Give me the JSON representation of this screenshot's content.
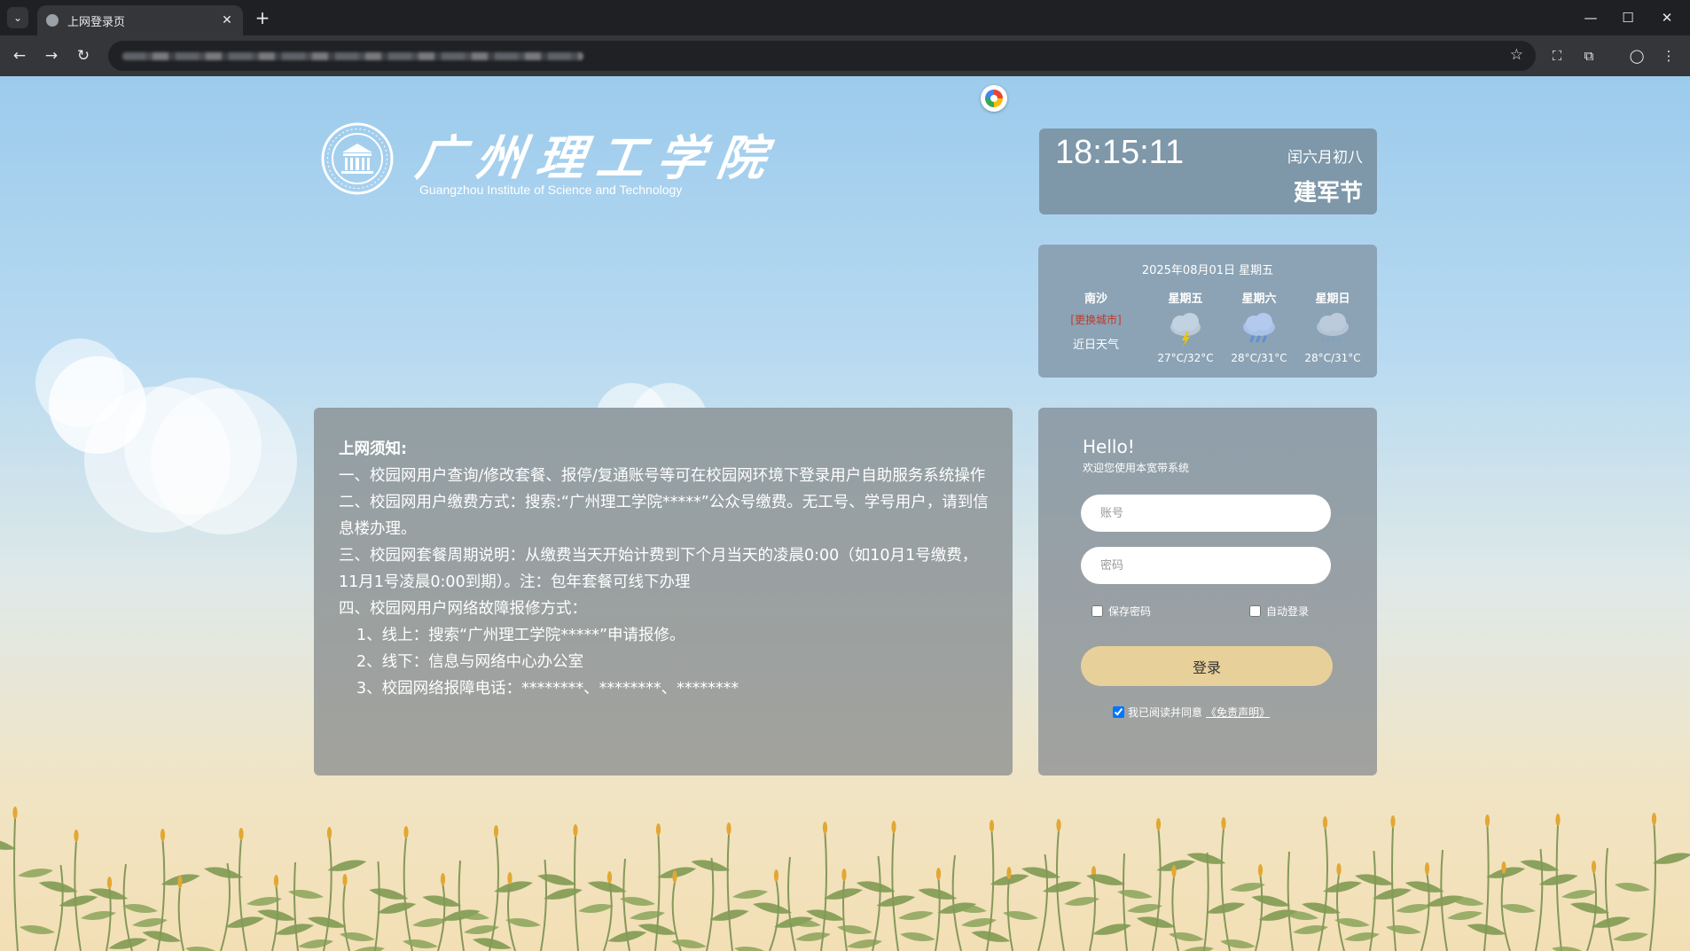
{
  "browser": {
    "tab_title": "上网登录页",
    "tab_close": "✕",
    "new_tab": "+",
    "tab_list": "⌄",
    "window": {
      "minimize": "—",
      "maximize": "☐",
      "close": "✕"
    },
    "nav": {
      "back": "←",
      "forward": "→",
      "reload": "↻"
    },
    "bookmark": "☆",
    "toolbar_icons": {
      "screenshot": "⛶",
      "extensions": "⧉",
      "profile": "◯",
      "menu": "⋮"
    }
  },
  "header": {
    "school_name_cn": "广州理工学院",
    "school_name_en": "Guangzhou Institute of Science and Technology"
  },
  "clock": {
    "time": "18:15:11",
    "lunar_date": "闰六月初八",
    "festival": "建军节"
  },
  "weather": {
    "date": "2025年08月01日 星期五",
    "city": "南沙",
    "change_city": "[更换城市]",
    "recent_label": "近日天气",
    "days": [
      {
        "name": "星期五",
        "icon": "thunderstorm-icon",
        "temp": "27°C/32°C"
      },
      {
        "name": "星期六",
        "icon": "rain-icon",
        "temp": "28°C/31°C"
      },
      {
        "name": "星期日",
        "icon": "light-rain-icon",
        "temp": "28°C/31°C"
      }
    ]
  },
  "notice": {
    "title": "上网须知:",
    "lines": [
      "一、校园网用户查询/修改套餐、报停/复通账号等可在校园网环境下登录用户自助服务系统操作",
      "二、校园网用户缴费方式：搜索:“广州理工学院*****”公众号缴费。无工号、学号用户，请到信息楼办理。",
      "三、校园网套餐周期说明：从缴费当天开始计费到下个月当天的凌晨0:00（如10月1号缴费，11月1号凌晨0:00到期）。注：包年套餐可线下办理",
      "四、校园网用户网络故障报修方式：",
      "1、线上：搜索“广州理工学院*****”申请报修。",
      "2、线下：信息与网络中心办公室",
      "3、校园网络报障电话：********、********、********"
    ]
  },
  "login": {
    "hello": "Hello!",
    "welcome": "欢迎您使用本宽带系统",
    "account_placeholder": "账号",
    "password_placeholder": "密码",
    "save_password": "保存密码",
    "auto_login": "自动登录",
    "submit": "登录",
    "agree_text": "我已阅读并同意",
    "disclaimer_link": "《免责声明》",
    "agree_checked": true
  }
}
